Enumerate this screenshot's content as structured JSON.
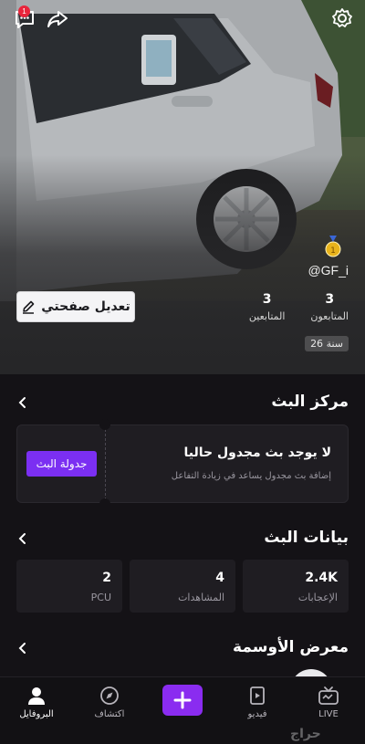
{
  "header": {
    "notification_count": "1",
    "handle": "@GF_i"
  },
  "profile": {
    "stats": [
      {
        "value": "3",
        "label": "المتابعون"
      },
      {
        "value": "3",
        "label": "المتابعين"
      }
    ],
    "age": "26 سنة",
    "edit_button": "تعديل صفحتي"
  },
  "stream_center": {
    "title": "مركز البث",
    "empty_title": "لا يوجد بث مجدول حاليا",
    "empty_subtitle": "إضافة بث مجدول يساعد في زيادة التفاعل",
    "schedule_button": "جدولة البث"
  },
  "stream_data": {
    "title": "بيانات البث",
    "cards": [
      {
        "value": "2.4K",
        "label": "الإعجابات"
      },
      {
        "value": "4",
        "label": "المشاهدات"
      },
      {
        "value": "2",
        "label": "PCU"
      }
    ]
  },
  "badges_gallery": {
    "title": "معرض الأوسمة"
  },
  "nav": {
    "live": "LIVE",
    "video": "فيديو",
    "explore": "اكتشاف",
    "profile": "البروفايل"
  },
  "watermark": "حراج",
  "colors": {
    "accent": "#7b2ff2",
    "background": "#141216",
    "card": "#1f1d22",
    "notification": "#e8253b"
  }
}
